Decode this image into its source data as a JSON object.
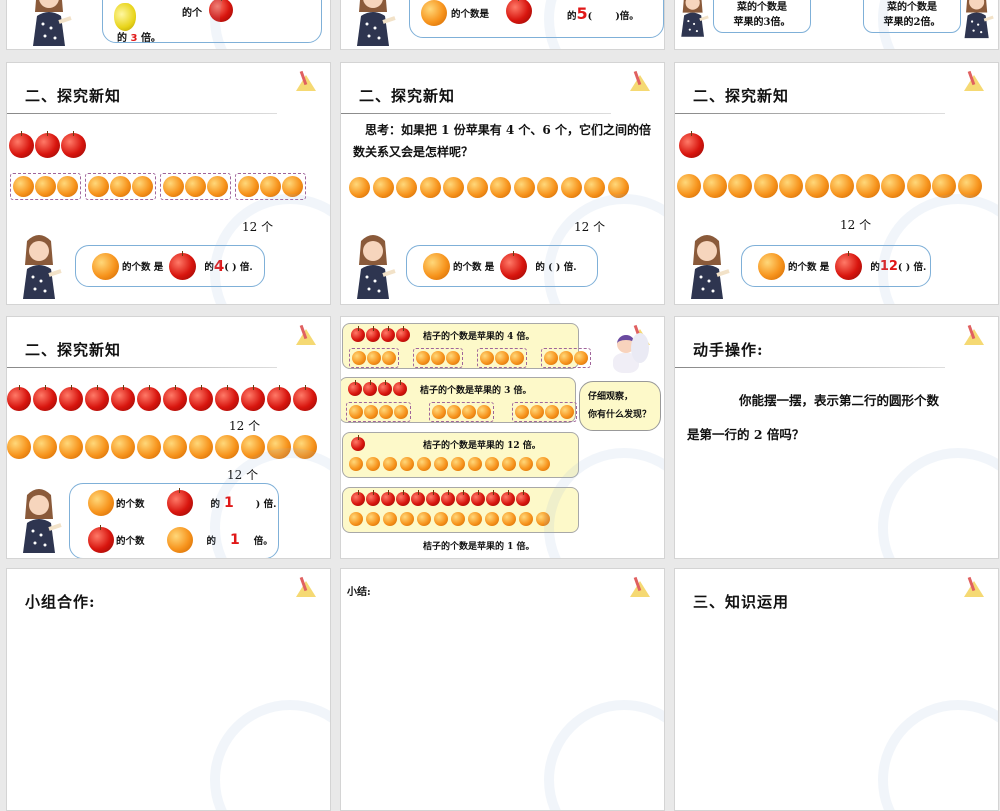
{
  "top_row": {
    "s1": {
      "text_a": "的个",
      "text_b": "的",
      "num": "3",
      "text_c": "倍。"
    },
    "s2": {
      "text_a": "的个数是",
      "text_b": "的",
      "num": "5",
      "text_c": "(",
      "text_d": ")倍。"
    },
    "s3": {
      "left_l1": "菜的个数是",
      "left_l2": "苹果的3倍。",
      "right_l1": "菜的个数是",
      "right_l2": "苹果的2倍。"
    }
  },
  "slide_4": {
    "title": "二、探究新知",
    "apples": 3,
    "orange_groups": [
      3,
      3,
      3,
      3
    ],
    "count": "12 个",
    "text_a": "的个数 是",
    "text_b": "的",
    "answer": "4",
    "text_c": "(      ) 倍."
  },
  "slide_5": {
    "title": "二、探究新知",
    "question": "思考：如果把 1 份苹果有 4 个、6 个，它们之间的倍数关系又会是怎样呢？",
    "oranges": 12,
    "count": "12 个",
    "text_a": "的个数 是",
    "text_b": "的 (      ) 倍."
  },
  "slide_6": {
    "title": "二、探究新知",
    "apples": 1,
    "oranges": 12,
    "count": "12 个",
    "text_a": "的个数 是",
    "text_b": "的",
    "answer": "12",
    "text_c": "(      ) 倍."
  },
  "slide_7": {
    "title": "二、探究新知",
    "apples": 12,
    "oranges": 12,
    "count_apples": "12 个",
    "count_oranges": "12 个",
    "line1_a": "的个数",
    "line1_b": "的",
    "line1_answer": "1",
    "line1_c": ") 倍.",
    "line2_a": "的个数",
    "line2_b": "的",
    "line2_answer": "1",
    "line2_c": "倍。"
  },
  "slide_8": {
    "boxes": [
      {
        "label": "桔子的个数是苹果的 4 倍。",
        "apples": 4,
        "groups": [
          3,
          3,
          3,
          3
        ]
      },
      {
        "label": "桔子的个数是苹果的 3 倍。",
        "apples": 4,
        "groups": [
          4,
          4,
          4
        ]
      },
      {
        "label": "桔子的个数是苹果的 12 倍。",
        "apples": 1,
        "groups": [
          12
        ]
      },
      {
        "label": "",
        "apples": 12,
        "groups": [
          12
        ]
      }
    ],
    "caption": "桔子的个数是苹果的 1 倍。",
    "bubble_l1": "仔细观察，",
    "bubble_l2": "你有什么发现？"
  },
  "slide_9": {
    "title": "动手操作:",
    "line1": "你能摆一摆，表示第二行的圆形个数",
    "line2": "是第一行的 2 倍吗？"
  },
  "bottom_row": {
    "s1_title": "小组合作:",
    "s2_title": "小结:",
    "s3_title": "三、知识运用"
  }
}
